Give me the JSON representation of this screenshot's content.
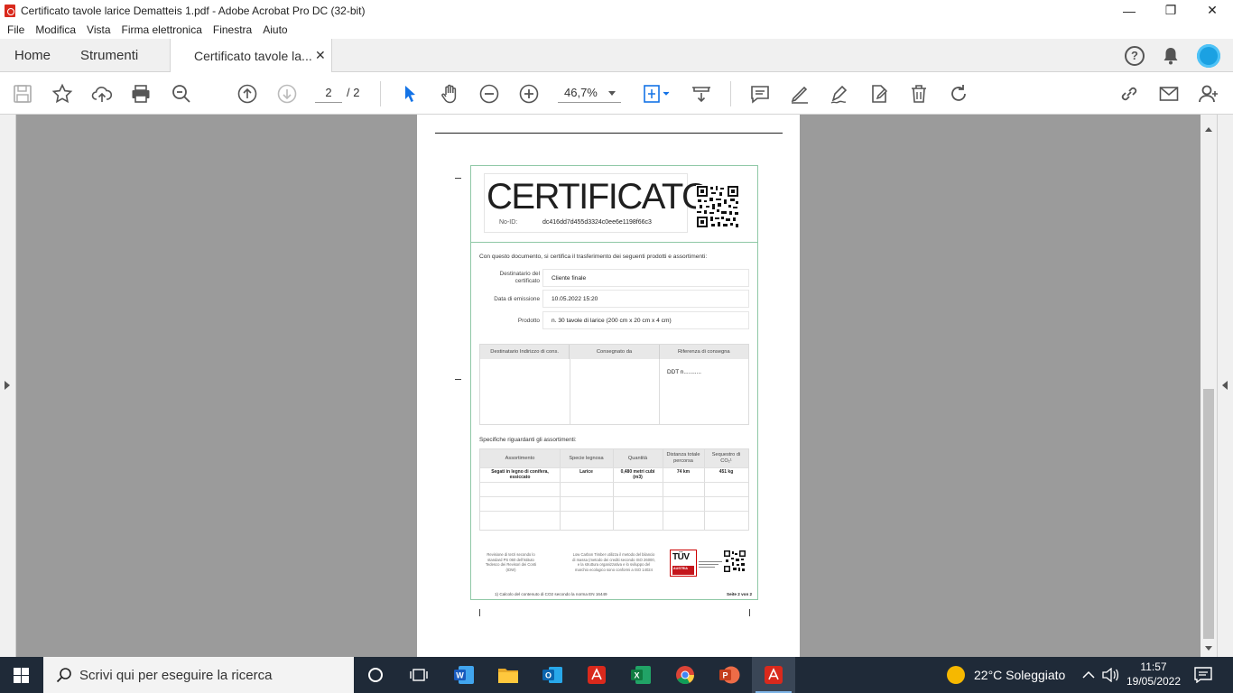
{
  "window": {
    "title": "Certificato tavole larice Dematteis 1.pdf - Adobe Acrobat Pro DC (32-bit)",
    "minimize": "—",
    "restore": "❐",
    "close": "✕"
  },
  "menu": [
    "File",
    "Modifica",
    "Vista",
    "Firma elettronica",
    "Finestra",
    "Aiuto"
  ],
  "tabs": {
    "home": "Home",
    "tools": "Strumenti",
    "document": "Certificato tavole la...",
    "close": "✕"
  },
  "toolbar": {
    "current_page": "2",
    "total_pages": "/ 2",
    "zoom": "46,7%"
  },
  "document": {
    "title": "CERTIFICATO",
    "no_id_label": "No-ID:",
    "no_id_value": "dc416dd7d455d3324c0ee6e1198f66c3",
    "intro": "Con questo documento, si certifica il trasferimento dei seguenti prodotti e assortimenti:",
    "fields": [
      {
        "label_line1": "Destinatario del",
        "label_line2": "certificato",
        "value": "Cliente finale"
      },
      {
        "label": "Data di emissione",
        "value": "10.05.2022 15:20"
      },
      {
        "label": "Prodotto",
        "value": "n. 30 tavole di larice (200 cm x 20 cm x 4 cm)"
      }
    ],
    "delivery_table": {
      "headers": [
        "Destinatario Indirizzo di cons.",
        "Consegnato da",
        "Riferenza di consegna"
      ],
      "ddt": "DDT n..........."
    },
    "spec_title": "Specifiche riguardanti gli assortimenti:",
    "spec_table": {
      "headers": [
        "Assortimento",
        "Specie legnosa",
        "Quantità",
        "Distanza totale percorsa",
        "Sequestro di CO₂¹"
      ],
      "row": [
        "Segati in legno di conifera, essiccato",
        "Larice",
        "0,480 metri cubi (m3)",
        "74 km",
        "451 kg"
      ]
    },
    "footer_left": "Revisione di terzi secondo lo standard PS 060 dell'istituto Tedesco dei Revisori dei Conti (IDW)",
    "footer_mid": "Low Carbon Timber utilizza il metodo del bilancio di massa (metodo dei crediti secondo ISO 26000, e la struttura organizzativa e lo sviluppo del marchio ecologico sono conformi a ISO 14024",
    "tuv_text": "TÜV",
    "tuv_sub": "AUSTRIA",
    "footnote": "1) Calcolo del contenuto di CO2 secondo la norma EN 16449",
    "page_label": "Seite 2 von 2"
  },
  "taskbar": {
    "search_placeholder": "Scrivi qui per eseguire la ricerca",
    "weather": "22°C  Soleggiato",
    "time": "11:57",
    "date": "19/05/2022"
  }
}
